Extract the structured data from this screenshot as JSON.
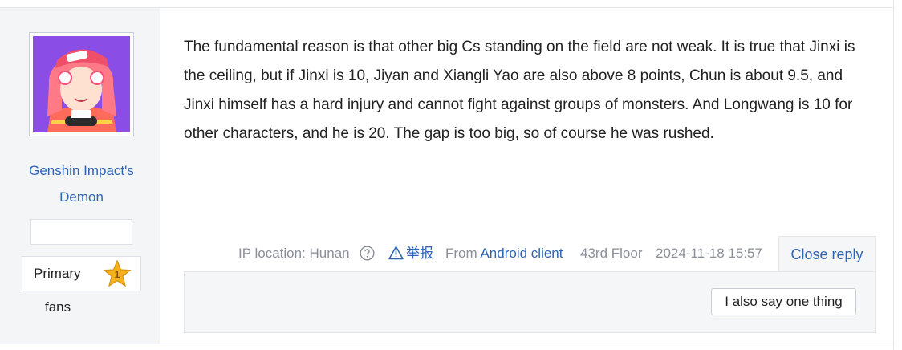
{
  "author": {
    "username": "Genshin Impact's Demon",
    "avatar_icon": "avatar-anime-girl-icon",
    "badge_text": "",
    "level": {
      "name": "Primary",
      "number": "1",
      "fans_label": "fans",
      "star_color": "#f5b21b"
    }
  },
  "post": {
    "content": "The fundamental reason is that other big Cs standing on the field are not weak. It is true that Jinxi is the ceiling, but if Jinxi is 10, Jiyan and Xiangli Yao are also above 8 points, Chun is about 9.5, and Jinxi himself has a hard injury and cannot fight against groups of monsters. And Longwang is 10 for other characters, and he is 20. The gap is too big, so of course he was rushed."
  },
  "meta": {
    "ip_location": "IP location: Hunan",
    "report_label": "举报",
    "from_prefix": "From",
    "from_client": "Android client",
    "floor": "43rd Floor",
    "timestamp": "2024-11-18 15:57"
  },
  "reply": {
    "toggle_label": "Close reply",
    "say_button": "I also say one thing"
  },
  "colors": {
    "link": "#2d64b3",
    "sidebar_bg": "#f4f5f7",
    "muted_text": "#8a8f99"
  }
}
